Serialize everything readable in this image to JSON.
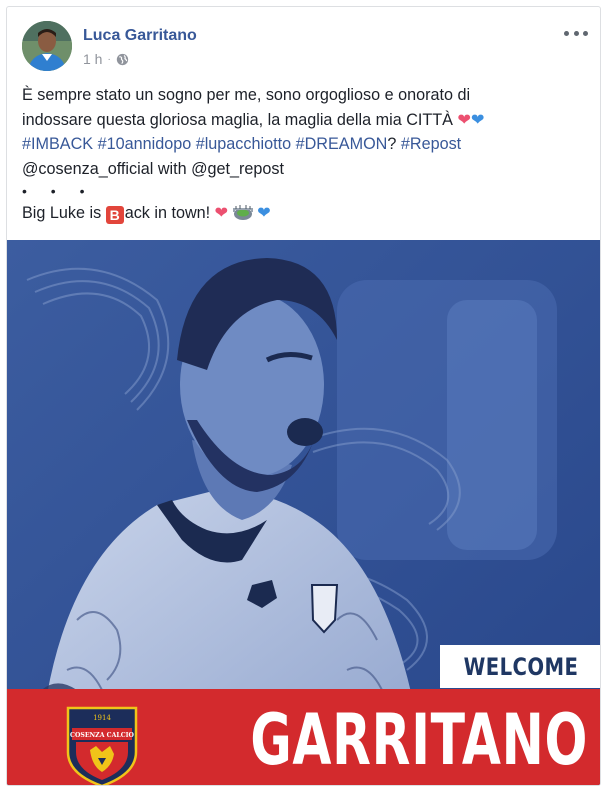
{
  "post": {
    "author": "Luca Garritano",
    "time": "1 h",
    "privacy_icon": "globe-icon",
    "more_icon": "more-options-icon",
    "text": {
      "line1": "È sempre stato un sogno per me, sono orgoglioso e onorato di",
      "line2": "indossare questa gloriosa maglia, la maglia della mia CITTÀ",
      "hashtags": [
        "#IMBACK",
        "#10annidopo",
        "#lupacchiotto",
        "#DREAMON"
      ],
      "hashtag_suffix": "?",
      "repost_tag": "#Repost",
      "mention_line": "@cosenza_official with @get_repost",
      "dots": "• • •",
      "big_luke_prefix": "Big Luke is ",
      "big_luke_b": "B",
      "big_luke_suffix": "ack in town!"
    }
  },
  "image": {
    "welcome": "WELCOME",
    "player_name": "GARRITANO",
    "crest_top": "1914",
    "crest_name": "COSENZA CALCIO",
    "colors": {
      "background_blue": "#2c4d92",
      "name_bar_red": "#d32a2d",
      "welcome_text": "#1f3763"
    }
  }
}
